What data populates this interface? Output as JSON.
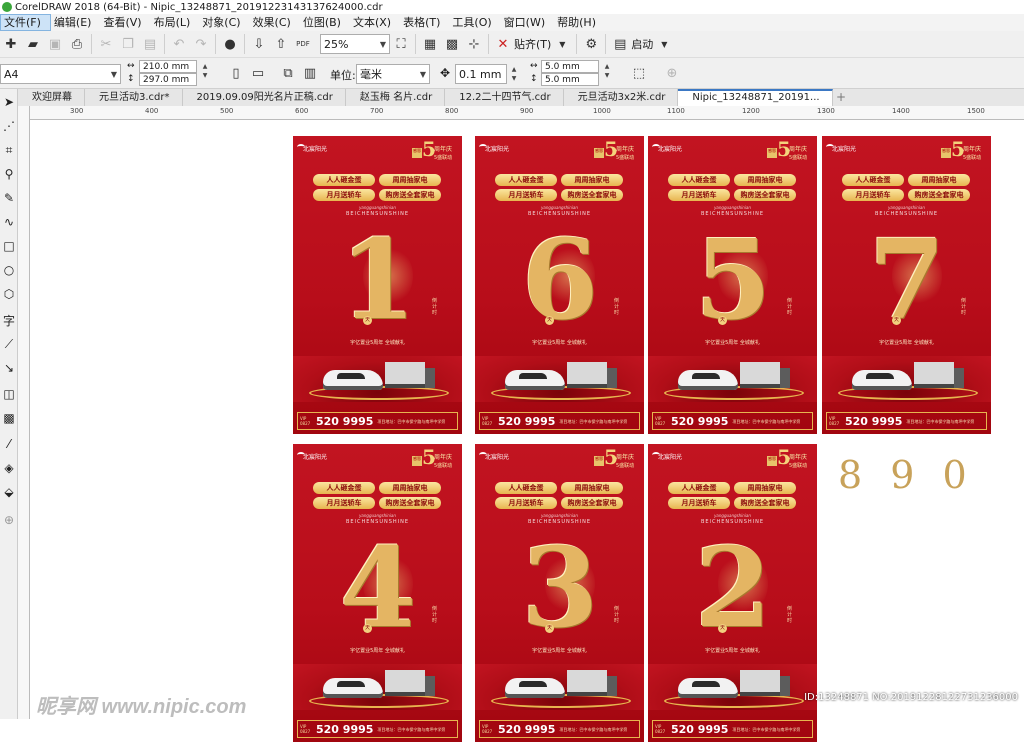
{
  "window": {
    "title": "CorelDRAW 2018 (64-Bit) - Nipic_13248871_20191223143137624000.cdr"
  },
  "menu": [
    "文件(F)",
    "编辑(E)",
    "查看(V)",
    "布局(L)",
    "对象(C)",
    "效果(C)",
    "位图(B)",
    "文本(X)",
    "表格(T)",
    "工具(O)",
    "窗口(W)",
    "帮助(H)"
  ],
  "toolbar": {
    "zoom": "25%",
    "pdf_label": "PDF",
    "snap_label": "贴齐(T)",
    "launch_label": "启动"
  },
  "property_bar": {
    "page_size": "A4",
    "width": "210.0 mm",
    "height": "297.0 mm",
    "unit_label": "单位:",
    "unit": "毫米",
    "nudge": "0.1 mm",
    "dup_x": "5.0 mm",
    "dup_y": "5.0 mm"
  },
  "tabs": [
    {
      "label": "欢迎屏幕",
      "active": false
    },
    {
      "label": "元旦活动3.cdr*",
      "active": false
    },
    {
      "label": "2019.09.09阳光名片正稿.cdr",
      "active": false
    },
    {
      "label": "赵玉梅 名片.cdr",
      "active": false
    },
    {
      "label": "12.2二十四节气.cdr",
      "active": false
    },
    {
      "label": "元旦活动3x2米.cdr",
      "active": false
    },
    {
      "label": "Nipic_13248871_20191...",
      "active": true
    }
  ],
  "ruler_labels": [
    "300",
    "400",
    "500",
    "600",
    "700",
    "800",
    "900",
    "1000",
    "1100",
    "1200",
    "1300",
    "1400",
    "1500"
  ],
  "toolbox": [
    "cursor",
    "node",
    "crop",
    "zoom",
    "freehand",
    "curve",
    "rect",
    "ellipse",
    "polygon",
    "text",
    "line",
    "connector",
    "shadow",
    "transparency",
    "eyedropper",
    "fill",
    "smartfill",
    "add"
  ],
  "poster_common": {
    "brand": "北宸阳光",
    "anniversary_big": "5",
    "anniversary_text": "周年庆",
    "anniversary_sub": "5盛联动",
    "badge": "感恩",
    "pill1": "人人砸金蛋",
    "pill2": "周周抽家电",
    "pill3": "月月送轿车",
    "pill4": "购房送全套家电",
    "slogan_sub": "yangguangshinian",
    "slogan_en": "BEICHENSUNSHINE",
    "tian": "天",
    "countdown_v": "倒计时",
    "tagline": "宇亿置业5周年  全城献礼",
    "vip": "VIP 0827",
    "phone": "520 9995",
    "address": "项目地址：巴中市保宁路与南坪中学旁"
  },
  "posters": [
    {
      "digit": "1"
    },
    {
      "digit": "6"
    },
    {
      "digit": "5"
    },
    {
      "digit": "7"
    },
    {
      "digit": "4"
    },
    {
      "digit": "3"
    },
    {
      "digit": "2"
    }
  ],
  "extra_digits": "8 9 0",
  "watermark": "昵享网 www.nipic.com",
  "watermark_id": "ID:13248871 NO:20191228122731236000"
}
